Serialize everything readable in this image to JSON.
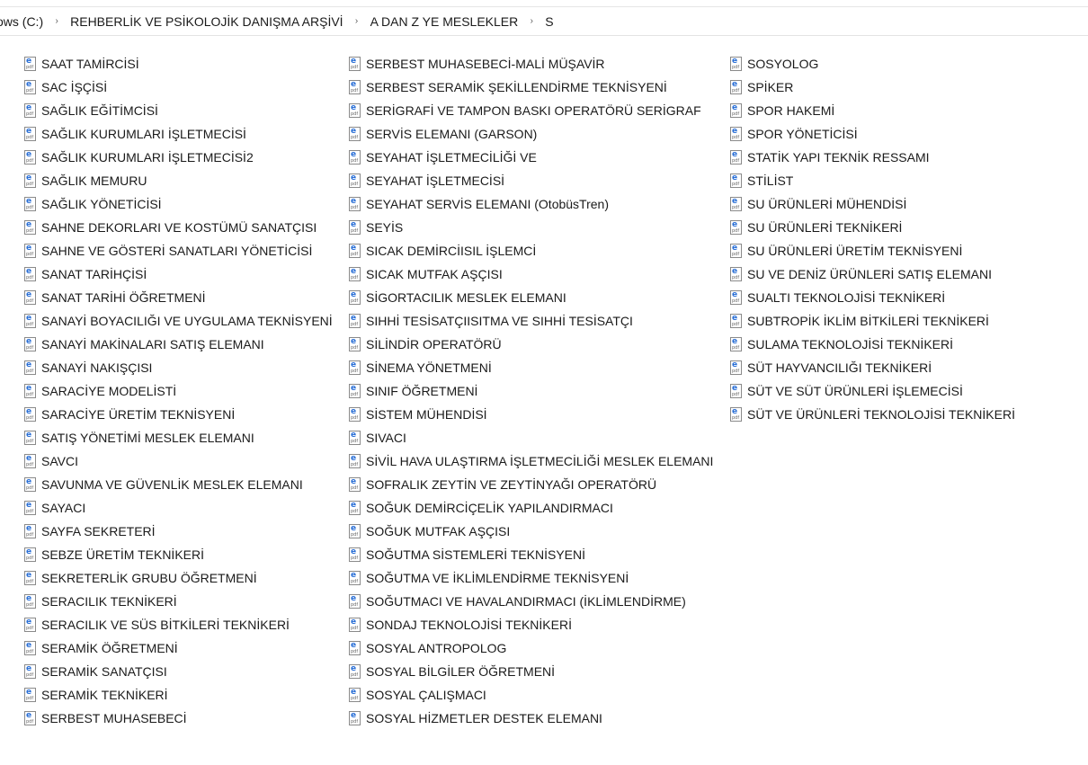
{
  "breadcrumb": {
    "items": [
      "ows (C:)",
      "REHBERLİK VE PSİKOLOJİK DANIŞMA ARŞİVİ",
      "A DAN Z YE MESLEKLER",
      "S"
    ],
    "separator": "›"
  },
  "icon_text": {
    "letter": "e",
    "sub": "pdf"
  },
  "files": {
    "col1": [
      "SAAT TAMİRCİSİ",
      "SAC İŞÇİSİ",
      "SAĞLIK EĞİTİMCİSİ",
      "SAĞLIK KURUMLARI İŞLETMECİSİ",
      "SAĞLIK KURUMLARI İŞLETMECİSİ2",
      "SAĞLIK MEMURU",
      "SAĞLIK YÖNETİCİSİ",
      "SAHNE DEKORLARI VE KOSTÜMÜ SANATÇISI",
      "SAHNE VE GÖSTERİ SANATLARI YÖNETİCİSİ",
      "SANAT TARİHÇİSİ",
      "SANAT TARİHİ ÖĞRETMENİ",
      "SANAYİ BOYACILIĞI VE UYGULAMA TEKNİSYENİ",
      "SANAYİ MAKİNALARI SATIŞ ELEMANI",
      "SANAYİ NAKIŞÇISI",
      "SARACİYE MODELİSTİ",
      "SARACİYE ÜRETİM TEKNİSYENİ",
      "SATIŞ YÖNETİMİ MESLEK ELEMANI",
      "SAVCI",
      "SAVUNMA VE GÜVENLİK MESLEK ELEMANI",
      "SAYACI",
      "SAYFA SEKRETERİ",
      "SEBZE ÜRETİM TEKNİKERİ",
      "SEKRETERLİK GRUBU ÖĞRETMENİ",
      "SERACILIK TEKNİKERİ",
      "SERACILIK VE SÜS BİTKİLERİ TEKNİKERİ",
      "SERAMİK ÖĞRETMENİ",
      "SERAMİK SANATÇISI",
      "SERAMİK TEKNİKERİ",
      "SERBEST MUHASEBECİ"
    ],
    "col2": [
      "SERBEST MUHASEBECİ-MALİ MÜŞAVİR",
      "SERBEST SERAMİK ŞEKİLLENDİRME TEKNİSYENİ",
      "SERİGRAFİ VE TAMPON BASKI OPERATÖRÜ  SERİGRAF",
      "SERVİS ELEMANI (GARSON)",
      "SEYAHAT İŞLETMECİLİĞİ VE",
      "SEYAHAT İŞLETMECİSİ",
      "SEYAHAT SERVİS ELEMANI (OtobüsTren)",
      "SEYİS",
      "SICAK DEMİRCİISIL İŞLEMCİ",
      "SICAK MUTFAK AŞÇISI",
      "SİGORTACILIK MESLEK ELEMANI",
      "SIHHİ TESİSATÇIISITMA VE SIHHİ TESİSATÇI",
      "SİLİNDİR OPERATÖRÜ",
      "SİNEMA YÖNETMENİ",
      "SINIF ÖĞRETMENİ",
      "SİSTEM MÜHENDİSİ",
      "SIVACI",
      "SİVİL HAVA ULAŞTIRMA İŞLETMECİLİĞİ MESLEK ELEMANI",
      "SOFRALIK ZEYTİN VE ZEYTİNYAĞI OPERATÖRÜ",
      "SOĞUK DEMİRCİÇELİK YAPILANDIRMACI",
      "SOĞUK MUTFAK AŞÇISI",
      "SOĞUTMA SİSTEMLERİ TEKNİSYENİ",
      "SOĞUTMA VE İKLİMLENDİRME TEKNİSYENİ",
      "SOĞUTMACI VE HAVALANDIRMACI (İKLİMLENDİRME)",
      "SONDAJ TEKNOLOJİSİ TEKNİKERİ",
      "SOSYAL ANTROPOLOG",
      "SOSYAL BİLGİLER ÖĞRETMENİ",
      "SOSYAL ÇALIŞMACI",
      "SOSYAL HİZMETLER DESTEK ELEMANI"
    ],
    "col3": [
      "SOSYOLOG",
      "SPİKER",
      "SPOR HAKEMİ",
      "SPOR YÖNETİCİSİ",
      "STATİK YAPI TEKNİK RESSAMI",
      "STİLİST",
      "SU ÜRÜNLERİ MÜHENDİSİ",
      "SU ÜRÜNLERİ TEKNİKERİ",
      "SU ÜRÜNLERİ ÜRETİM TEKNİSYENİ",
      "SU VE DENİZ ÜRÜNLERİ SATIŞ ELEMANI",
      "SUALTI TEKNOLOJİSİ TEKNİKERİ",
      "SUBTROPİK İKLİM BİTKİLERİ TEKNİKERİ",
      "SULAMA TEKNOLOJİSİ TEKNİKERİ",
      "SÜT HAYVANCILIĞI TEKNİKERİ",
      "SÜT VE SÜT ÜRÜNLERİ İŞLEMECİSİ",
      "SÜT VE ÜRÜNLERİ TEKNOLOJİSİ TEKNİKERİ"
    ]
  }
}
